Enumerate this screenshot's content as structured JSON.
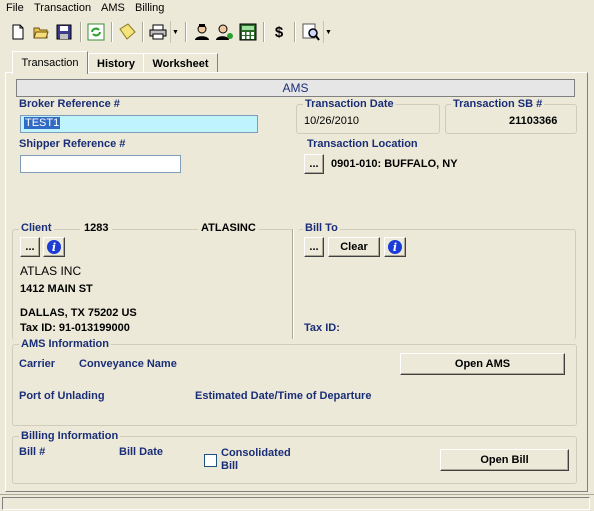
{
  "menu": {
    "items": [
      {
        "label": "File"
      },
      {
        "label": "Transaction"
      },
      {
        "label": "AMS"
      },
      {
        "label": "Billing"
      }
    ]
  },
  "toolbar": {
    "icons": [
      "new-document-icon",
      "open-folder-icon",
      "save-icon",
      "refresh-icon",
      "note-icon",
      "print-icon",
      "user-icon",
      "user-transfer-icon",
      "calculator-icon",
      "dollar-icon",
      "search-settings-icon"
    ],
    "dollar_label": "$"
  },
  "tabs": [
    {
      "label": "Transaction"
    },
    {
      "label": "History"
    },
    {
      "label": "Worksheet"
    }
  ],
  "header": {
    "title": "AMS"
  },
  "broker": {
    "label": "Broker Reference #",
    "value": "TEST1"
  },
  "shipper": {
    "label": "Shipper Reference #",
    "value": ""
  },
  "transaction_date": {
    "label": "Transaction Date",
    "value": "10/26/2010"
  },
  "transaction_sb": {
    "label": "Transaction SB #",
    "value": "21103366"
  },
  "transaction_location": {
    "label": "Transaction Location",
    "button": "...",
    "value": "0901-010: BUFFALO, NY"
  },
  "client": {
    "label": "Client",
    "number": "1283",
    "code": "ATLASINC",
    "button": "...",
    "name": "ATLAS INC",
    "address1": "1412 MAIN ST",
    "city_line": "DALLAS, TX 75202  US",
    "tax_id": "Tax ID: 91-013199000"
  },
  "bill_to": {
    "label": "Bill To",
    "button": "...",
    "clear": "Clear",
    "tax_id": "Tax ID:"
  },
  "ams_info": {
    "title": "AMS Information",
    "carrier": "Carrier",
    "conveyance": "Conveyance Name",
    "open_button": "Open AMS",
    "port": "Port of Unlading",
    "departure": "Estimated Date/Time of Departure"
  },
  "billing_info": {
    "title": "Billing Information",
    "bill_no": "Bill #",
    "bill_date": "Bill Date",
    "consolidated_1": "Consolidated",
    "consolidated_2": "Bill",
    "open_button": "Open Bill"
  },
  "colors": {
    "label": "#1a2e78",
    "selection": "#bff4ff",
    "info": "#1c3cd6"
  }
}
